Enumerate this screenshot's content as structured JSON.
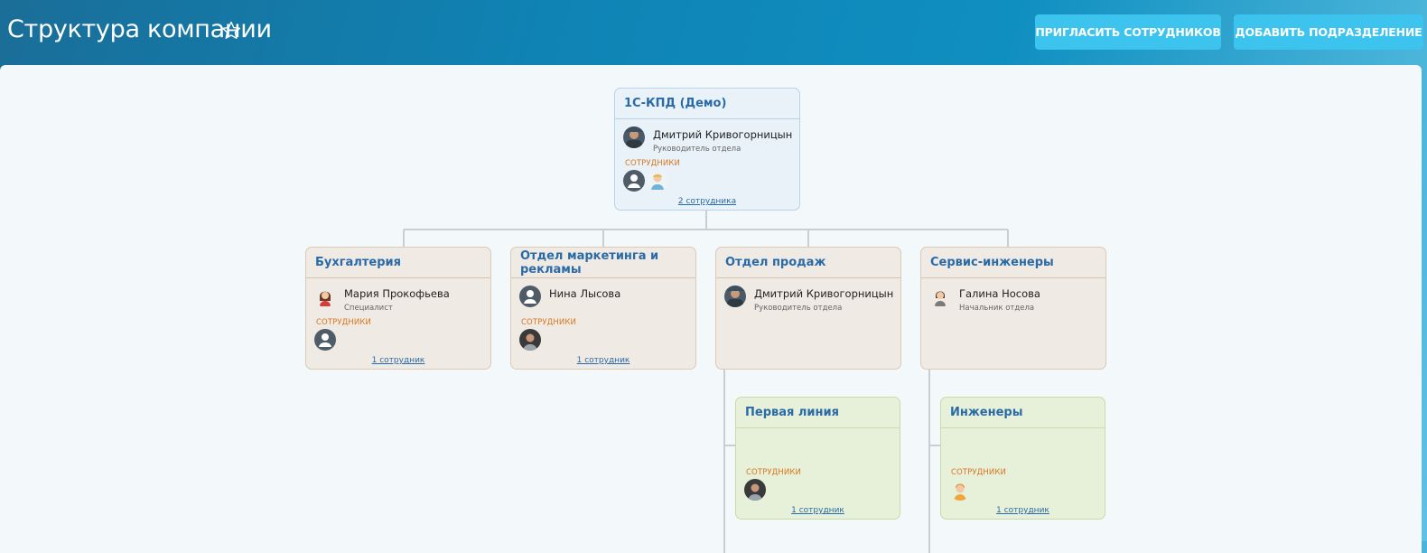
{
  "header": {
    "title": "Структура компании",
    "invite_button": "ПРИГЛАСИТЬ СОТРУДНИКОВ",
    "add_button": "ДОБАВИТЬ ПОДРАЗДЕЛЕНИЕ"
  },
  "colors": {
    "header_gradient_start": "#1a6e98",
    "header_gradient_end": "#5fc1e2",
    "button": "#3cc3ee",
    "card_title": "#2a6aa6",
    "employees_label": "#d8761e",
    "root_card_bg": "#e9f2f9",
    "dept_card_bg": "#efeae4",
    "sub_card_bg": "#e7f0d9"
  },
  "root": {
    "title": "1С-КПД (Демо)",
    "head_name": "Дмитрий Кривогорницын",
    "head_role": "Руководитель отдела",
    "employees_label": "СОТРУДНИКИ",
    "employees_link": "2 сотрудника"
  },
  "departments": [
    {
      "title": "Бухгалтерия",
      "head_name": "Мария Прокофьева",
      "head_role": "Специалист",
      "employees_label": "СОТРУДНИКИ",
      "employees_link": "1 сотрудник"
    },
    {
      "title": "Отдел маркетинга и рекламы",
      "head_name": "Нина Лысова",
      "head_role": "",
      "employees_label": "СОТРУДНИКИ",
      "employees_link": "1 сотрудник"
    },
    {
      "title": "Отдел продаж",
      "head_name": "Дмитрий Кривогорницын",
      "head_role": "Руководитель отдела"
    },
    {
      "title": "Сервис-инженеры",
      "head_name": "Галина Носова",
      "head_role": "Начальник отдела"
    }
  ],
  "subdepartments": [
    {
      "title": "Первая линия",
      "employees_label": "СОТРУДНИКИ",
      "employees_link": "1 сотрудник"
    },
    {
      "title": "Инженеры",
      "employees_label": "СОТРУДНИКИ",
      "employees_link": "1 сотрудник"
    }
  ]
}
